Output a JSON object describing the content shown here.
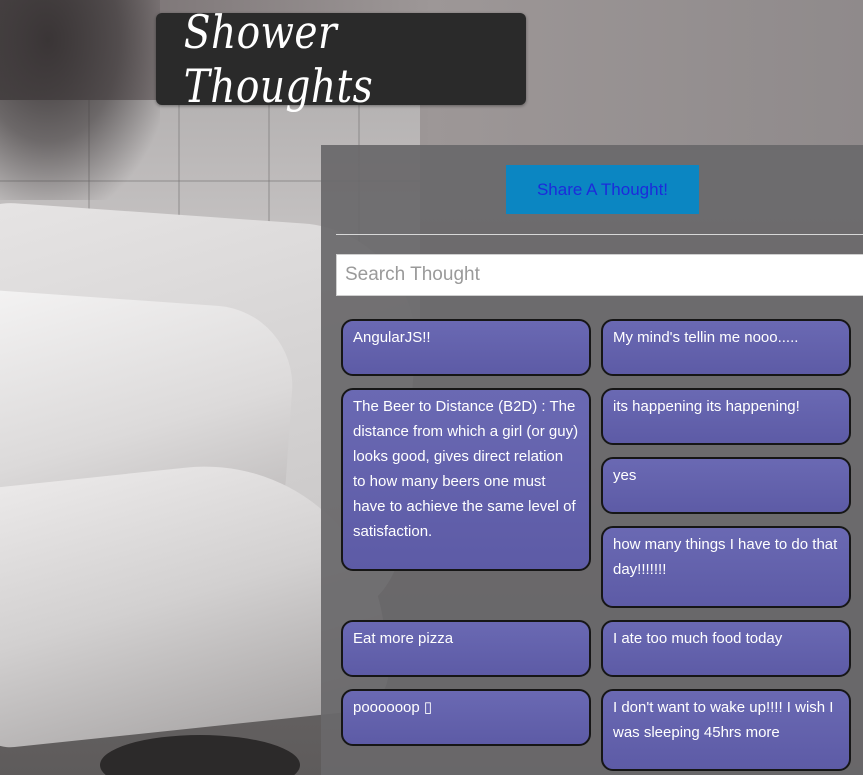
{
  "app": {
    "title": "Shower Thoughts"
  },
  "toolbar": {
    "share_label": "Share A Thought!"
  },
  "search": {
    "placeholder": "Search Thought",
    "value": ""
  },
  "thoughts": [
    {
      "text": "AngularJS!!"
    },
    {
      "text": "My mind's tellin me nooo....."
    },
    {
      "text": "The Beer to Distance (B2D) : The distance from which a girl (or guy) looks good, gives direct relation to how many beers one must have to achieve the same level of satisfaction."
    },
    {
      "text": "its happening its happening!"
    },
    {
      "text": "yes"
    },
    {
      "text": "how many things I have to do that day!!!!!!!"
    },
    {
      "text": "Eat more pizza"
    },
    {
      "text": "I ate too much food today"
    },
    {
      "text": "poooooop ▯"
    },
    {
      "text": "I don't want to wake up!!!! I wish I was sleeping 45hrs more"
    }
  ],
  "colors": {
    "title_plate": "#2a2a2a",
    "share_button": "#0b86c2",
    "share_button_text": "#1c2bdb",
    "card_fill": "#6564ae",
    "panel": "#69686a"
  }
}
